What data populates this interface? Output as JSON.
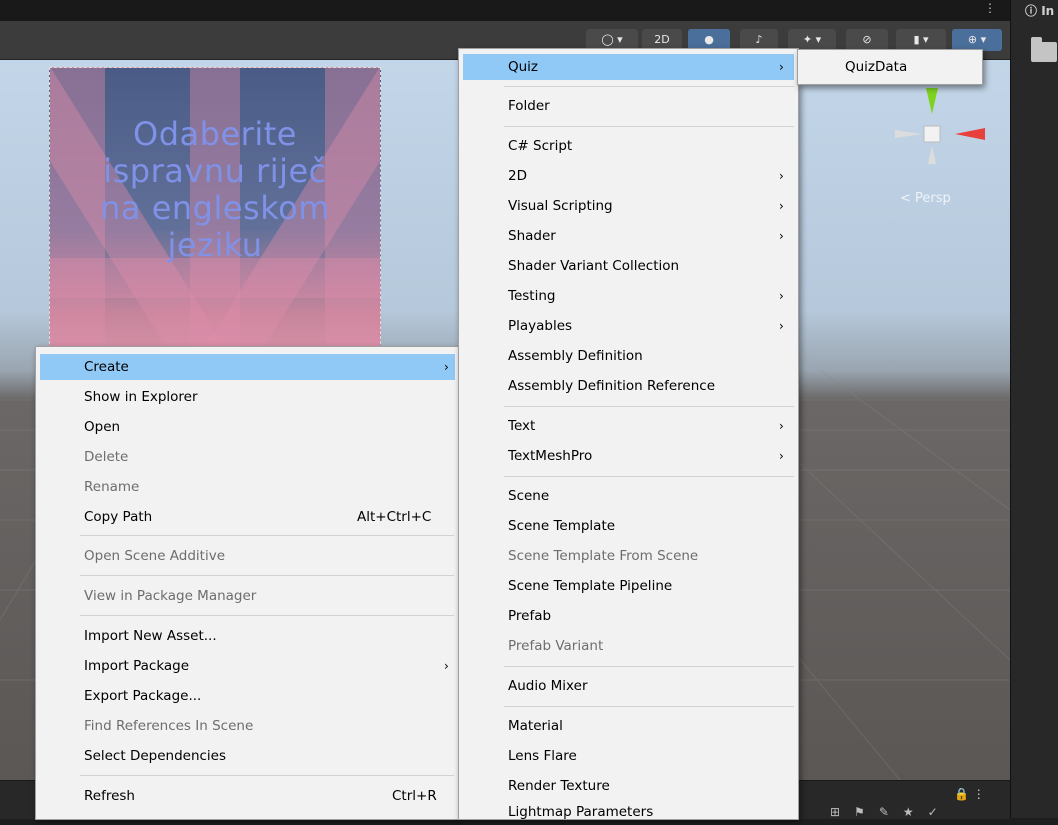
{
  "window": {
    "inspector_label": "In",
    "scene_view": {
      "panel_text_lines": [
        "Odaberite",
        "ispravnu riječ",
        "na engleskom",
        "jeziku"
      ],
      "persp_label": "Persp",
      "toolbar": {
        "mode_2d_label": "2D"
      }
    }
  },
  "context_menu": {
    "items": [
      {
        "label": "Create",
        "has_submenu": true,
        "highlighted": true,
        "enabled": true
      },
      {
        "label": "Show in Explorer",
        "enabled": true
      },
      {
        "label": "Open",
        "enabled": true
      },
      {
        "label": "Delete",
        "enabled": false
      },
      {
        "label": "Rename",
        "enabled": false
      },
      {
        "label": "Copy Path",
        "shortcut": "Alt+Ctrl+C",
        "enabled": true
      },
      {
        "label": "Open Scene Additive",
        "enabled": false
      },
      {
        "label": "View in Package Manager",
        "enabled": false
      },
      {
        "label": "Import New Asset...",
        "enabled": true
      },
      {
        "label": "Import Package",
        "has_submenu": true,
        "enabled": true
      },
      {
        "label": "Export Package...",
        "enabled": true
      },
      {
        "label": "Find References In Scene",
        "enabled": false
      },
      {
        "label": "Select Dependencies",
        "enabled": true
      },
      {
        "label": "Refresh",
        "shortcut": "Ctrl+R",
        "enabled": true
      }
    ]
  },
  "create_submenu": {
    "items": [
      {
        "label": "Quiz",
        "has_submenu": true,
        "highlighted": true,
        "enabled": true
      },
      {
        "label": "Folder",
        "enabled": true
      },
      {
        "label": "C# Script",
        "enabled": true
      },
      {
        "label": "2D",
        "has_submenu": true,
        "enabled": true
      },
      {
        "label": "Visual Scripting",
        "has_submenu": true,
        "enabled": true
      },
      {
        "label": "Shader",
        "has_submenu": true,
        "enabled": true
      },
      {
        "label": "Shader Variant Collection",
        "enabled": true
      },
      {
        "label": "Testing",
        "has_submenu": true,
        "enabled": true
      },
      {
        "label": "Playables",
        "has_submenu": true,
        "enabled": true
      },
      {
        "label": "Assembly Definition",
        "enabled": true
      },
      {
        "label": "Assembly Definition Reference",
        "enabled": true
      },
      {
        "label": "Text",
        "has_submenu": true,
        "enabled": true
      },
      {
        "label": "TextMeshPro",
        "has_submenu": true,
        "enabled": true
      },
      {
        "label": "Scene",
        "enabled": true
      },
      {
        "label": "Scene Template",
        "enabled": true
      },
      {
        "label": "Scene Template From Scene",
        "enabled": false
      },
      {
        "label": "Scene Template Pipeline",
        "enabled": true
      },
      {
        "label": "Prefab",
        "enabled": true
      },
      {
        "label": "Prefab Variant",
        "enabled": false
      },
      {
        "label": "Audio Mixer",
        "enabled": true
      },
      {
        "label": "Material",
        "enabled": true
      },
      {
        "label": "Lens Flare",
        "enabled": true
      },
      {
        "label": "Render Texture",
        "enabled": true
      },
      {
        "label": "Lightmap Parameters",
        "enabled": true
      }
    ]
  },
  "quiz_submenu": {
    "items": [
      {
        "label": "QuizData",
        "enabled": true
      }
    ]
  },
  "colors": {
    "menu_bg": "#f2f2f2",
    "highlight": "#90c8f6",
    "disabled_text": "#6d6d6d",
    "panel_text": "#7f92e8"
  }
}
